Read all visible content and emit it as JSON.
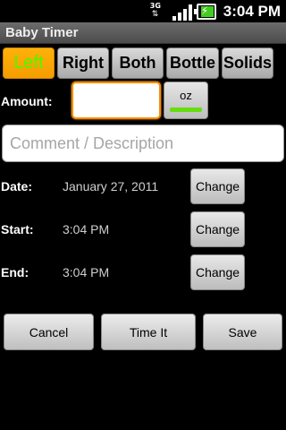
{
  "status_bar": {
    "network_label": "3G",
    "time": "3:04 PM",
    "battery_color": "#44cc22"
  },
  "app": {
    "title": "Baby Timer"
  },
  "types": [
    {
      "label": "Left",
      "active": true
    },
    {
      "label": "Right",
      "active": false
    },
    {
      "label": "Both",
      "active": false
    },
    {
      "label": "Bottle",
      "active": false
    },
    {
      "label": "Solids",
      "active": false
    }
  ],
  "amount": {
    "label": "Amount:",
    "value": "",
    "unit": "oz"
  },
  "comment": {
    "placeholder": "Comment / Description",
    "value": ""
  },
  "date": {
    "label": "Date:",
    "value": "January 27, 2011",
    "button": "Change"
  },
  "start": {
    "label": "Start:",
    "value": "3:04 PM",
    "button": "Change"
  },
  "end": {
    "label": "End:",
    "value": "3:04 PM",
    "button": "Change"
  },
  "actions": {
    "cancel": "Cancel",
    "time_it": "Time It",
    "save": "Save"
  },
  "colors": {
    "active_tab_bg": "#f8a600",
    "active_tab_text": "#44ff00",
    "input_focus": "#ff8a00"
  }
}
